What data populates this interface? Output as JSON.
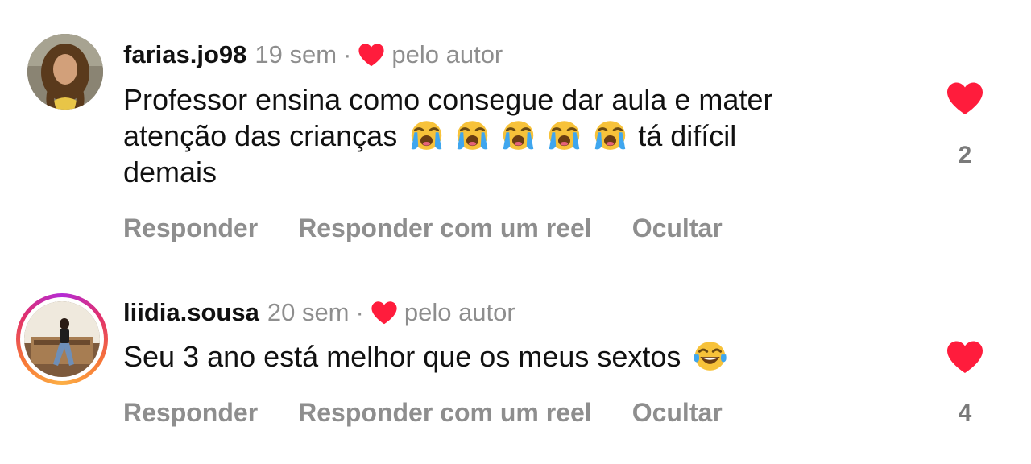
{
  "colors": {
    "heart": "#ff1c3c",
    "muted_text": "#8e8e8e",
    "primary_text": "#111111",
    "story_ring": [
      "#b42bd6",
      "#e1306c",
      "#f77737",
      "#fcaf45"
    ]
  },
  "comments": [
    {
      "username": "farias.jo98",
      "time": "19 sem",
      "separator": "·",
      "liked_by_author_label": "pelo autor",
      "text_line_1": "Professor ensina como consegue dar aula e mater",
      "text_line_2_start": "atenção das crianças",
      "text_line_2_end": "tá difícil",
      "text_line_3": "demais",
      "emojis": [
        "loudly-crying-face",
        "loudly-crying-face",
        "loudly-crying-face",
        "loudly-crying-face",
        "loudly-crying-face"
      ],
      "actions": [
        "Responder",
        "Responder com um reel",
        "Ocultar"
      ],
      "like_count": "2",
      "liked": true,
      "avatar_story_ring": false
    },
    {
      "username": "liidia.sousa",
      "time": "20 sem",
      "separator": "·",
      "liked_by_author_label": "pelo autor",
      "text": "Seu 3 ano está melhor que os meus sextos",
      "emojis": [
        "face-with-tears-of-joy"
      ],
      "actions": [
        "Responder",
        "Responder com um reel",
        "Ocultar"
      ],
      "like_count": "4",
      "liked": true,
      "avatar_story_ring": true
    }
  ]
}
